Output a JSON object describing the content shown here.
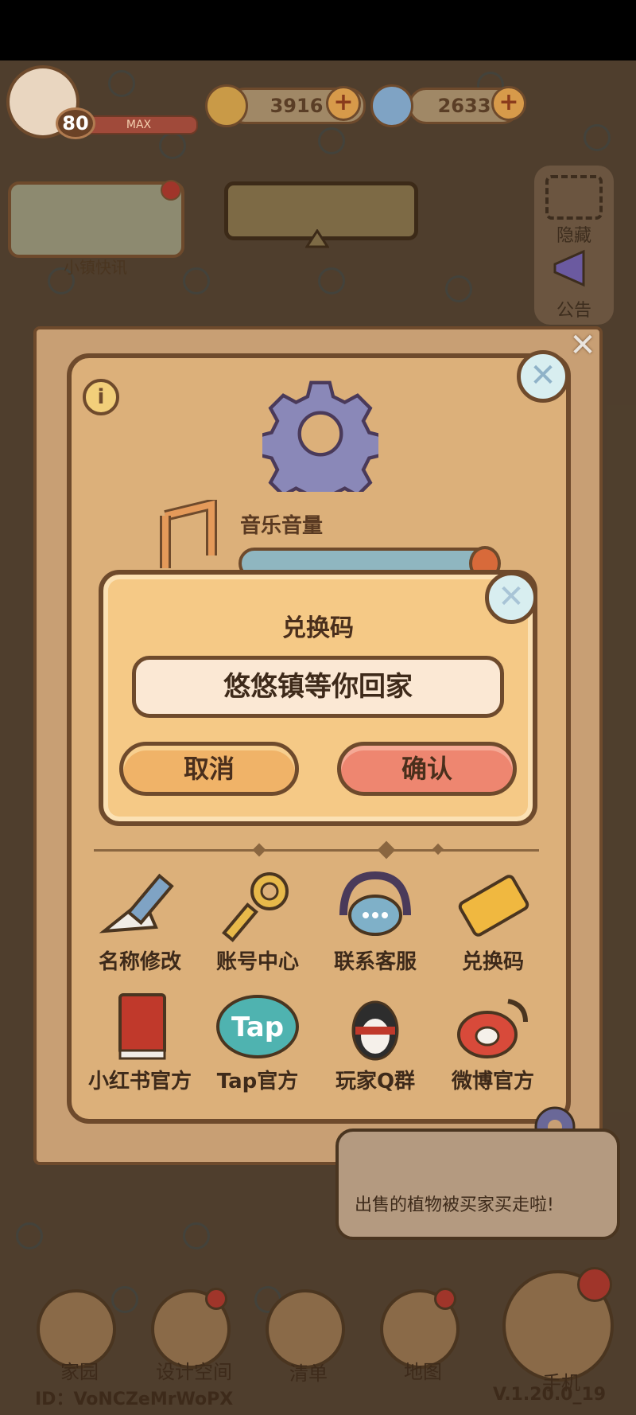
{
  "hud": {
    "level": "80",
    "level_bar_label": "MAX",
    "coins": "3916",
    "gems": "2633",
    "plus_symbol": "+"
  },
  "side": {
    "news_label": "小镇快讯",
    "hide_label": "隐藏",
    "notice_label": "公告"
  },
  "settings": {
    "info_symbol": "i",
    "close_symbol": "✕",
    "music_volume_label": "音乐音量",
    "grid": [
      {
        "label": "名称修改",
        "icon": "pencil-icon"
      },
      {
        "label": "账号中心",
        "icon": "key-icon"
      },
      {
        "label": "联系客服",
        "icon": "headset-icon"
      },
      {
        "label": "兑换码",
        "icon": "ticket-icon"
      },
      {
        "label": "小红书官方",
        "icon": "xiaohongshu-book-icon"
      },
      {
        "label": "Tap官方",
        "icon": "tap-logo-icon"
      },
      {
        "label": "玩家Q群",
        "icon": "qq-penguin-icon"
      },
      {
        "label": "微博官方",
        "icon": "weibo-icon"
      }
    ]
  },
  "dialog": {
    "title": "兑换码",
    "input_value": "悠悠镇等你回家",
    "cancel_label": "取消",
    "confirm_label": "确认",
    "close_symbol": "✕"
  },
  "bubble": {
    "text": "出售的植物被买家买走啦!"
  },
  "nav": [
    {
      "label": "家园",
      "icon": "home-icon",
      "badge": false
    },
    {
      "label": "设计空间",
      "icon": "design-ruler-icon",
      "badge": true
    },
    {
      "label": "清单",
      "icon": "list-icon",
      "badge": false
    },
    {
      "label": "地图",
      "icon": "map-pin-icon",
      "badge": true
    },
    {
      "label": "手机",
      "icon": "phone-icon",
      "badge": true
    }
  ],
  "footer": {
    "player_id": "ID：VoNCZeMrWoPX",
    "version": "V.1.20.0_19"
  },
  "colors": {
    "panel": "#dcb07a",
    "dialog": "#f5c986",
    "outline": "#6e4a2c",
    "cancel": "#f0b368",
    "confirm": "#ee8670"
  }
}
